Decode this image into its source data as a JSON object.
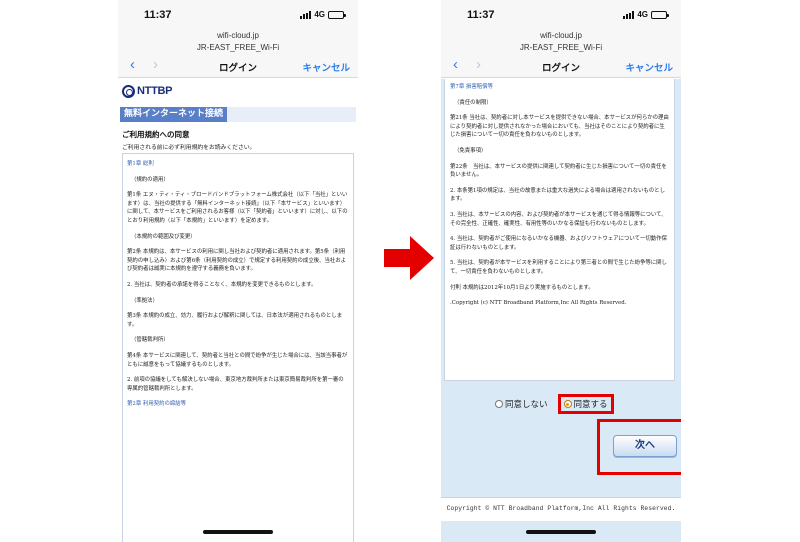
{
  "left_phone": {
    "status": {
      "time": "11:37",
      "network": "4G",
      "battery_level": 0.85
    },
    "url": {
      "domain": "wifi-cloud.jp",
      "ssid": "JR-EAST_FREE_Wi-Fi"
    },
    "nav": {
      "back": "‹",
      "forward": "›",
      "title": "ログイン",
      "cancel": "キャンセル"
    },
    "logo_text": "NTTBP",
    "service_tag": "無料インターネット接続",
    "agree_title": "ご利用規約への同意",
    "agree_subtitle": "ご利用される前に必ず利用規約をお読みください。",
    "terms": [
      {
        "text": "第1章 総則",
        "kind": "chap"
      },
      {
        "text": "（規約の適用）",
        "kind": "sec"
      },
      {
        "text": "第1条 エヌ・ティ・ティ・ブロードバンドプラットフォーム株式会社（以下「当社」といいます）は、当社の提供する「無料インターネット接続」（以下「本サービス」といいます）に関して、本サービスをご利用されるお客様（以下「契約者」といいます）に対し、以下のとおり利用規約（以下「本規約」といいます）を定めます。",
        "kind": ""
      },
      {
        "text": "（本規約の範囲及び変更）",
        "kind": "sec"
      },
      {
        "text": "第2条 本規約は、本サービスの利用に関し当社および契約者に適用されます。第5条（利用契約の申し込み）および第6条（利用契約の成立）で規定する利用契約の成立後、当社および契約者は誠実に本規約を遵守する義務を負います。",
        "kind": ""
      },
      {
        "text": "2. 当社は、契約者の承諾を得ることなく、本規約を変更できるものとします。",
        "kind": ""
      },
      {
        "text": "（準拠法）",
        "kind": "sec"
      },
      {
        "text": "第3条 本規約の成立、効力、履行および解釈に関しては、日本法が適用されるものとします。",
        "kind": ""
      },
      {
        "text": "（管轄裁判所）",
        "kind": "sec"
      },
      {
        "text": "第4条 本サービスに関連して、契約者と当社との間で紛争が生じた場合には、当該当事者がともに誠意をもって協議するものとします。",
        "kind": ""
      },
      {
        "text": "2. 前項の協議をしても解決しない場合、東京地方裁判所または東京簡易裁判所を第一審の専属的管轄裁判所とします。",
        "kind": ""
      },
      {
        "text": "第2章 利用契約の締結等",
        "kind": "chap"
      }
    ]
  },
  "right_phone": {
    "status": {
      "time": "11:37",
      "network": "4G",
      "battery_level": 0.85
    },
    "url": {
      "domain": "wifi-cloud.jp",
      "ssid": "JR-EAST_FREE_Wi-Fi"
    },
    "nav": {
      "back": "‹",
      "forward": "›",
      "title": "ログイン",
      "cancel": "キャンセル"
    },
    "terms": [
      {
        "text": "第7章 損害賠償等",
        "kind": "chap"
      },
      {
        "text": "（責任の制限）",
        "kind": "sec"
      },
      {
        "text": "第21条 当社は、契約者に対し本サービスを提供できない場合、本サービスが何らかの理由により契約者に対し提供されなかった場合においても、当社はそのことにより契約者に生じた損害について一切の責任を負わないものとします。",
        "kind": ""
      },
      {
        "text": "（免責事項）",
        "kind": "sec"
      },
      {
        "text": "第22条　当社は、本サービスの提供に関連して契約者に生じた損害について一切の責任を負いません。",
        "kind": ""
      },
      {
        "text": "2. 本条第1項の規定は、当社の故意または重大な過失による場合は適用されないものとします。",
        "kind": ""
      },
      {
        "text": "3. 当社は、本サービスの内容、および契約者が本サービスを通じて得る情報等について、その完全性、正確性、確実性、有用性等のいかなる保証も行わないものとします。",
        "kind": ""
      },
      {
        "text": "4. 当社は、契約者がご使用になるいかなる機器、およびソフトウェアについて一切動作保証は行わないものとします。",
        "kind": ""
      },
      {
        "text": "5. 当社は、契約者が本サービスを利用することにより第三者との間で生じた紛争等に関して、一切責任を負わないものとします。",
        "kind": ""
      },
      {
        "text": "付則 本規約は2012年10月1日より実施するものとします。",
        "kind": ""
      },
      {
        "text": ".Copyright (c) NTT Broadband Platform,Inc All Rights Reserved.",
        "kind": "copy"
      }
    ],
    "radio": {
      "disagree": "同意しない",
      "agree": "同意する",
      "selected": "agree"
    },
    "next_button": "次へ",
    "footer": "Copyright © NTT Broadband Platform,Inc All Rights Reserved."
  },
  "colors": {
    "accent_blue": "#2b7de9",
    "highlight_red": "#e50000",
    "form_bg": "#d9e9f6"
  }
}
